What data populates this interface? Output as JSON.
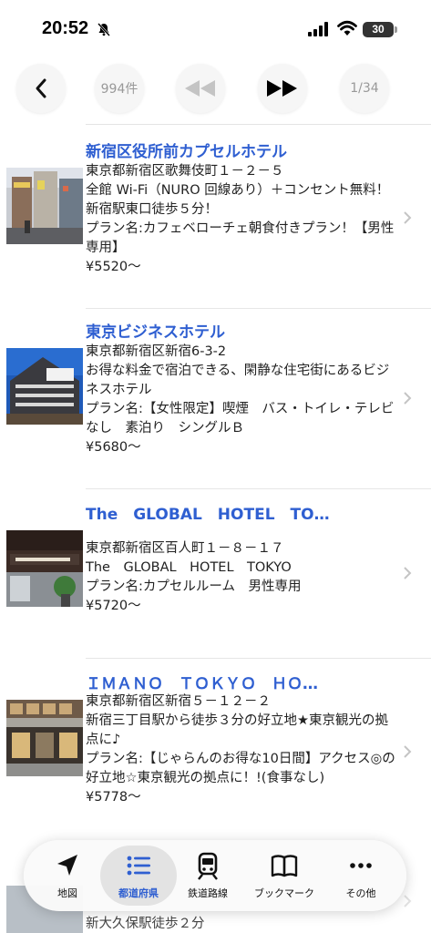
{
  "status": {
    "time": "20:52",
    "battery": "30"
  },
  "nav": {
    "count": "994件",
    "page": "1/34"
  },
  "hotels": [
    {
      "name": "新宿区役所前カプセルホテル",
      "lines": [
        "東京都新宿区歌舞伎町１－２－５",
        "全館 Wi-Fi（NURO 回線あり）＋コンセント無料！",
        "新宿駅東口徒歩５分！",
        "プラン名:カフェベローチェ朝食付きプラン！【男性専用】",
        "¥5520〜"
      ]
    },
    {
      "name": "東京ビジネスホテル",
      "lines": [
        "東京都新宿区新宿6-3-2",
        "お得な料金で宿泊できる、閑静な住宅街にあるビジネスホテル",
        "プラン名:【女性限定】喫煙　バス・トイレ・テレビなし　素泊り　シングルＢ",
        "¥5680〜"
      ]
    },
    {
      "name": "The　GLOBAL　HOTEL　TO…",
      "lines": [
        "東京都新宿区百人町１－８－１７",
        "The　GLOBAL　HOTEL　TOKYO",
        "プラン名:カプセルルーム　男性専用",
        "¥5720〜"
      ]
    },
    {
      "name": "ＩＭＡＮＯ　ＴＯＫＹＯ　ＨＯ…",
      "lines": [
        "東京都新宿区新宿５－１２－２",
        "新宿三丁目駅から徒歩３分の好立地★東京観光の拠点に♪",
        "プラン名:【じゃらんのお得な10日間】アクセス◎の好立地☆東京観光の拠点に！!(食事なし)",
        "¥5778〜"
      ]
    }
  ],
  "ghost": {
    "line": "新大久保駅徒歩２分"
  },
  "tabs": [
    {
      "label": "地図",
      "icon": "location-arrow-icon"
    },
    {
      "label": "都道府県",
      "icon": "list-icon"
    },
    {
      "label": "鉄道路線",
      "icon": "train-icon"
    },
    {
      "label": "ブックマーク",
      "icon": "book-icon"
    },
    {
      "label": "その他",
      "icon": "more-icon"
    }
  ],
  "colors": {
    "accent": "#2f5fd1",
    "title": "#2f5fd1"
  }
}
